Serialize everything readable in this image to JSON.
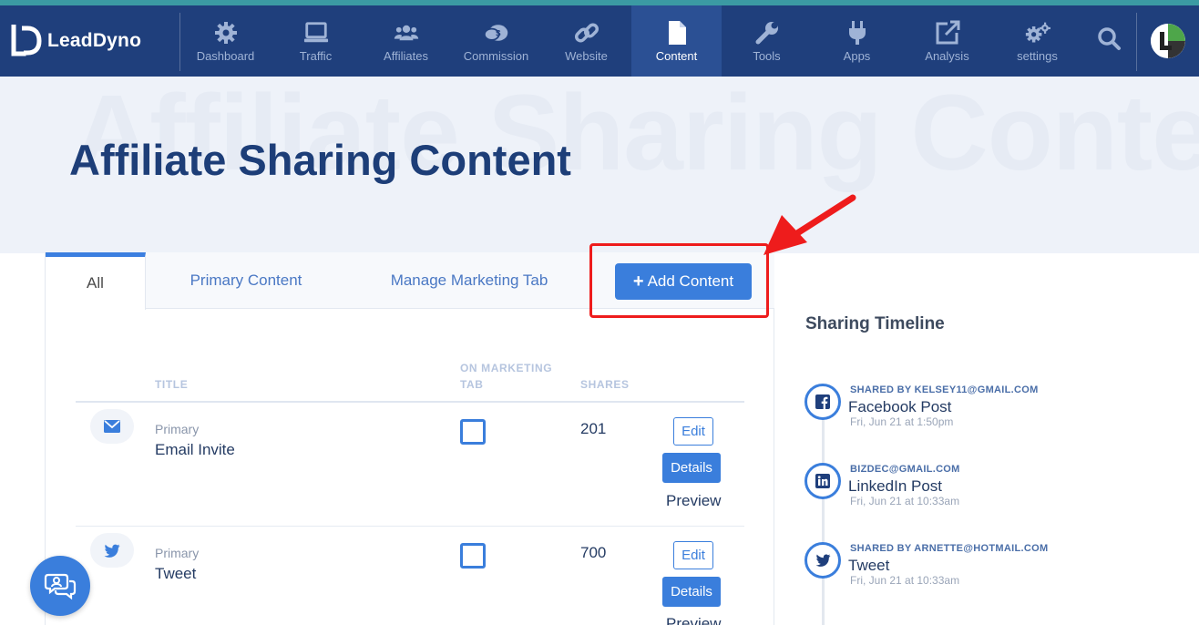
{
  "brand": {
    "name": "LeadDyno"
  },
  "nav": {
    "items": [
      {
        "label": "Dashboard",
        "icon": "gear-icon"
      },
      {
        "label": "Traffic",
        "icon": "laptop-icon"
      },
      {
        "label": "Affiliates",
        "icon": "users-icon"
      },
      {
        "label": "Commission",
        "icon": "money-chat-icon"
      },
      {
        "label": "Website",
        "icon": "link-icon"
      },
      {
        "label": "Content",
        "icon": "file-icon",
        "active": true
      },
      {
        "label": "Tools",
        "icon": "wrench-icon"
      },
      {
        "label": "Apps",
        "icon": "plug-icon"
      },
      {
        "label": "Analysis",
        "icon": "external-edit-icon"
      },
      {
        "label": "settings",
        "icon": "gears-icon"
      }
    ]
  },
  "hero": {
    "watermark": "Affiliate Sharing Content",
    "title": "Affiliate Sharing Content"
  },
  "tabs": [
    {
      "label": "All",
      "active": true
    },
    {
      "label": "Primary Content"
    },
    {
      "label": "Manage Marketing Tab"
    }
  ],
  "add_button": {
    "label": "Add Content"
  },
  "table": {
    "headers": {
      "title": "TITLE",
      "on_marketing_tab_line1": "ON MARKETING",
      "on_marketing_tab_line2": "TAB",
      "shares": "SHARES"
    },
    "rows": [
      {
        "type": "Primary",
        "title": "Email Invite",
        "icon": "envelope-icon",
        "shares": "201",
        "edit": "Edit",
        "details": "Details",
        "preview": "Preview"
      },
      {
        "type": "Primary",
        "title": "Tweet",
        "icon": "twitter-icon",
        "shares": "700",
        "edit": "Edit",
        "details": "Details",
        "preview": "Preview"
      }
    ]
  },
  "sidebar": {
    "title": "Sharing Timeline",
    "events": [
      {
        "by": "SHARED BY KELSEY11@GMAIL.COM",
        "title": "Facebook Post",
        "time": "Fri, Jun 21 at 1:50pm",
        "icon": "facebook-icon"
      },
      {
        "by": "BIZDEC@GMAIL.COM",
        "title": "LinkedIn Post",
        "time": "Fri, Jun 21 at 10:33am",
        "icon": "linkedin-icon"
      },
      {
        "by": "SHARED BY ARNETTE@HOTMAIL.COM",
        "title": "Tweet",
        "time": "Fri, Jun 21 at 10:33am",
        "icon": "twitter-icon"
      }
    ]
  },
  "colors": {
    "nav_bg": "#1f3f7c",
    "nav_active": "#2b5094",
    "accent_blue": "#3a7edc",
    "title_navy": "#1d3e78",
    "highlight_red": "#ee1c1c"
  }
}
